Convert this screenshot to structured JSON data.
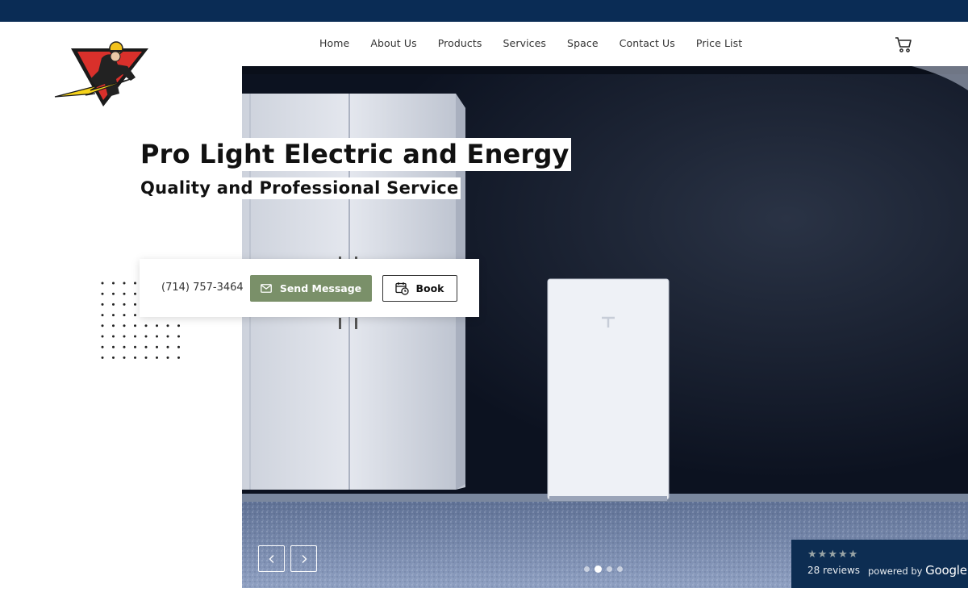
{
  "colors": {
    "topbar": "#0a2c55",
    "accent_green": "#7a9069",
    "reviews_bg": "#0d2d52"
  },
  "logo": {
    "icon": "electrician-lightning-logo"
  },
  "nav": {
    "items": [
      {
        "label": "Home"
      },
      {
        "label": "About Us"
      },
      {
        "label": "Products"
      },
      {
        "label": "Services"
      },
      {
        "label": "Space"
      },
      {
        "label": "Contact Us"
      },
      {
        "label": "Price List"
      }
    ],
    "cart_icon": "cart-icon"
  },
  "hero": {
    "title": "Pro Light Electric and Energy",
    "subtitle": "Quality and Professional Service",
    "image_subject": "garage-with-cabinets-and-home-battery"
  },
  "cta": {
    "phone": "(714) 757-3464",
    "send_message_label": "Send Message",
    "book_label": "Book"
  },
  "slider": {
    "slide_count": 4,
    "active_slide": 2
  },
  "reviews": {
    "rating_stars": 5,
    "count_label": "28 reviews",
    "powered_label": "powered by",
    "brand": "Google"
  }
}
